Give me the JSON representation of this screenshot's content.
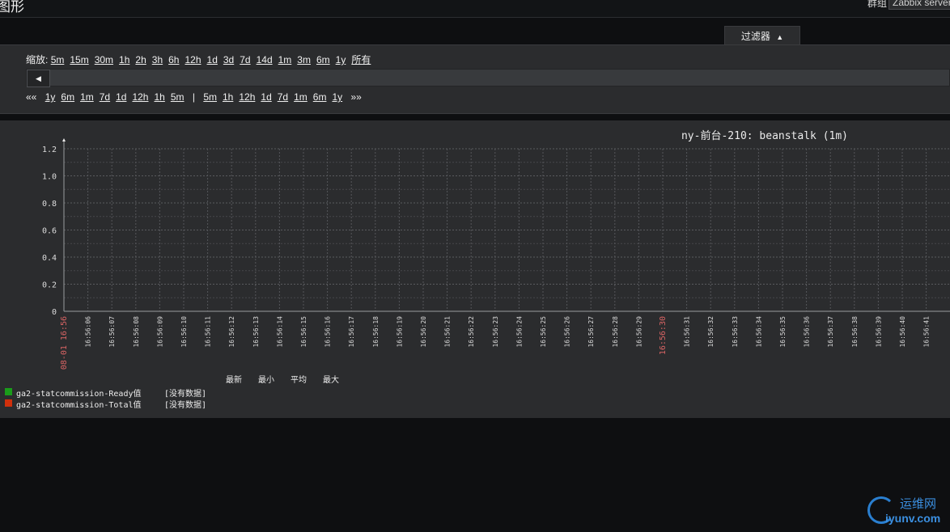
{
  "header": {
    "page_title": "图形",
    "group_label": "群组",
    "group_value": "Zabbix servers"
  },
  "filter": {
    "tab_label": "过滤器",
    "tab_icon": "triangle-up-icon",
    "zoom_label": "缩放:",
    "zoom_options": [
      "5m",
      "15m",
      "30m",
      "1h",
      "2h",
      "3h",
      "6h",
      "12h",
      "1d",
      "3d",
      "7d",
      "14d",
      "1m",
      "3m",
      "6m",
      "1y",
      "所有"
    ],
    "nav_back_label": "««",
    "nav_back_options": [
      "1y",
      "6m",
      "1m",
      "7d",
      "1d",
      "12h",
      "1h",
      "5m"
    ],
    "nav_separator": "|",
    "nav_forward_options": [
      "5m",
      "1h",
      "12h",
      "1d",
      "7d",
      "1m",
      "6m",
      "1y"
    ],
    "nav_forward_label": "»»",
    "scroll_left_icon": "triangle-left-icon"
  },
  "chart_data": {
    "type": "line",
    "title": "ny-前台-210: beanstalk (1m)",
    "ylim": [
      0,
      1.2
    ],
    "y_ticks": [
      "0",
      "0.2",
      "0.4",
      "0.6",
      "0.8",
      "1.0",
      "1.2"
    ],
    "x_ticks": [
      {
        "label": "08-01 16:56",
        "highlight": true
      },
      {
        "label": "16:56:06"
      },
      {
        "label": "16:56:07"
      },
      {
        "label": "16:56:08"
      },
      {
        "label": "16:56:09"
      },
      {
        "label": "16:56:10"
      },
      {
        "label": "16:56:11"
      },
      {
        "label": "16:56:12"
      },
      {
        "label": "16:56:13"
      },
      {
        "label": "16:56:14"
      },
      {
        "label": "16:56:15"
      },
      {
        "label": "16:56:16"
      },
      {
        "label": "16:56:17"
      },
      {
        "label": "16:56:18"
      },
      {
        "label": "16:56:19"
      },
      {
        "label": "16:56:20"
      },
      {
        "label": "16:56:21"
      },
      {
        "label": "16:56:22"
      },
      {
        "label": "16:56:23"
      },
      {
        "label": "16:56:24"
      },
      {
        "label": "16:56:25"
      },
      {
        "label": "16:56:26"
      },
      {
        "label": "16:56:27"
      },
      {
        "label": "16:56:28"
      },
      {
        "label": "16:56:29"
      },
      {
        "label": "16:56:30",
        "highlight": true
      },
      {
        "label": "16:56:31"
      },
      {
        "label": "16:56:32"
      },
      {
        "label": "16:56:33"
      },
      {
        "label": "16:56:34"
      },
      {
        "label": "16:56:35"
      },
      {
        "label": "16:56:36"
      },
      {
        "label": "16:56:37"
      },
      {
        "label": "16:56:38"
      },
      {
        "label": "16:56:39"
      },
      {
        "label": "16:56:40"
      },
      {
        "label": "16:56:41"
      }
    ],
    "grid": true,
    "series": [
      {
        "name": "ga2-statcommission-Ready值",
        "color": "#1a9c1a",
        "values": [],
        "status": "[没有数据]"
      },
      {
        "name": "ga2-statcommission-Total值",
        "color": "#d0300c",
        "values": [],
        "status": "[没有数据]"
      }
    ],
    "legend_columns": [
      "最新",
      "最小",
      "平均",
      "最大"
    ],
    "legend_position": "bottom-left"
  },
  "colors": {
    "background": "#0e0f11",
    "panel": "#2b2c2e",
    "grid": "#5a5b5e",
    "highlight_tick": "#d86464"
  },
  "watermark": {
    "top_text": "运维网",
    "bottom_text": "iyunv.com",
    "icon": "logo-swirl-icon"
  }
}
